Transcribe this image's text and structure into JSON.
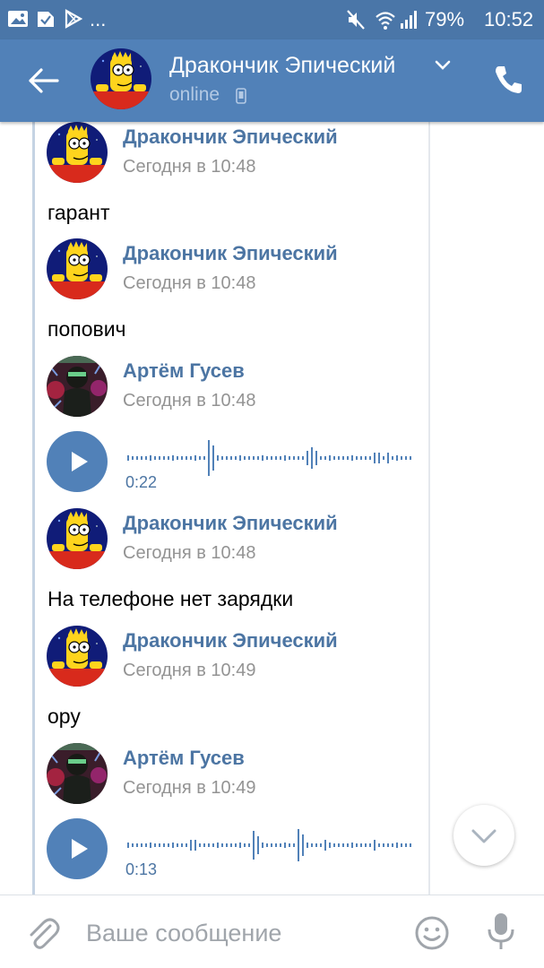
{
  "status_bar": {
    "more_indicator": "...",
    "battery": "79%",
    "time": "10:52"
  },
  "header": {
    "name": "Дракончик Эпический",
    "status": "online"
  },
  "messages": [
    {
      "type": "text",
      "author": "Дракончик Эпический",
      "time": "Сегодня в 10:48",
      "text": "гарант",
      "avatar": "bart-avatar"
    },
    {
      "type": "text",
      "author": "Дракончик Эпический",
      "time": "Сегодня в 10:48",
      "text": "попович",
      "avatar": "bart-avatar"
    },
    {
      "type": "voice",
      "author": "Артём Гусев",
      "time": "Сегодня в 10:48",
      "duration": "0:22",
      "avatar": "artem-avatar"
    },
    {
      "type": "text",
      "author": "Дракончик Эпический",
      "time": "Сегодня в 10:48",
      "text": "На телефоне нет зарядки",
      "avatar": "bart-avatar"
    },
    {
      "type": "text",
      "author": "Дракончик Эпический",
      "time": "Сегодня в 10:49",
      "text": "ору",
      "avatar": "bart-avatar"
    },
    {
      "type": "voice",
      "author": "Артём Гусев",
      "time": "Сегодня в 10:49",
      "duration": "0:13",
      "avatar": "artem-avatar"
    }
  ],
  "composer": {
    "placeholder": "Ваше сообщение"
  },
  "colors": {
    "status_bar": "#4a76a8",
    "app_bar": "#5181b8",
    "author": "#4c75a3",
    "timestamp": "#939393",
    "play_button": "#5181b8"
  },
  "icons": [
    "image-icon",
    "check-icon",
    "play-store-icon",
    "mute-icon",
    "wifi-icon",
    "signal-icon",
    "back-arrow-icon",
    "chevron-down-icon",
    "phone-device-icon",
    "phone-call-icon",
    "play-icon",
    "paperclip-icon",
    "smile-icon",
    "microphone-icon"
  ]
}
